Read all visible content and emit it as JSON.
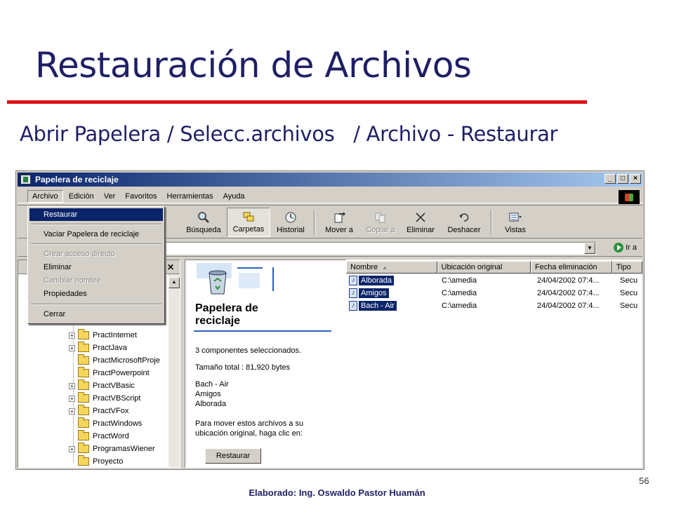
{
  "slide": {
    "title": "Restauración de Archivos",
    "subtitle": "Abrir Papelera / Selecc.archivos   / Archivo - Restaurar",
    "author": "Elaborado: Ing. Oswaldo Pastor Huamán",
    "page_number": "56"
  },
  "window": {
    "title": "Papelera de reciclaje",
    "buttons": {
      "minimize": "_",
      "maximize": "□",
      "close": "×"
    }
  },
  "menubar": [
    "Archivo",
    "Edición",
    "Ver",
    "Favoritos",
    "Herramientas",
    "Ayuda"
  ],
  "file_menu": {
    "items": [
      {
        "label": "Restaurar",
        "state": "highlighted"
      },
      {
        "label": "Vaciar Papelera de reciclaje",
        "state": "normal"
      },
      {
        "label": "Crear acceso directo",
        "state": "disabled"
      },
      {
        "label": "Eliminar",
        "state": "normal"
      },
      {
        "label": "Cambiar nombre",
        "state": "disabled"
      },
      {
        "label": "Propiedades",
        "state": "normal"
      },
      {
        "label": "Cerrar",
        "state": "normal"
      }
    ]
  },
  "toolbar": {
    "buttons": [
      {
        "label": "Búsqueda",
        "icon": "search-icon"
      },
      {
        "label": "Carpetas",
        "icon": "folders-icon"
      },
      {
        "label": "Historial",
        "icon": "history-icon"
      },
      {
        "label": "Mover a",
        "icon": "move-to-icon"
      },
      {
        "label": "Copiar a",
        "icon": "copy-to-icon"
      },
      {
        "label": "Eliminar",
        "icon": "delete-icon"
      },
      {
        "label": "Deshacer",
        "icon": "undo-icon"
      },
      {
        "label": "Vistas",
        "icon": "views-icon"
      }
    ]
  },
  "address": {
    "go_label": "Ir a"
  },
  "tree": {
    "items": [
      {
        "label": "PractInternet",
        "expandable": true
      },
      {
        "label": "PractJava",
        "expandable": true
      },
      {
        "label": "PractMicrosoftProje",
        "expandable": false
      },
      {
        "label": "PractPowerpoint",
        "expandable": false
      },
      {
        "label": "PractVBasic",
        "expandable": true
      },
      {
        "label": "PractVBScript",
        "expandable": true
      },
      {
        "label": "PractVFox",
        "expandable": true
      },
      {
        "label": "PractWindows",
        "expandable": false
      },
      {
        "label": "PractWord",
        "expandable": false
      },
      {
        "label": "ProgramasWiener",
        "expandable": true
      },
      {
        "label": "Proyecto",
        "expandable": false
      }
    ]
  },
  "web_view": {
    "title_line1": "Papelera de",
    "title_line2": "reciclaje",
    "selected_count": "3 componentes seleccionados.",
    "total_size": "Tamaño total : 81,920 bytes",
    "selected_files": [
      "Bach - Air",
      "Amigos",
      "Alborada"
    ],
    "instructions_line1": "Para mover estos archivos a su",
    "instructions_line2": "ubicación original, haga clic en:",
    "restore_button": "Restaurar"
  },
  "file_list": {
    "columns": [
      "Nombre",
      "Ubicación original",
      "Fecha eliminación",
      "Tipo"
    ],
    "rows": [
      {
        "name": "Alborada",
        "location": "C:\\amedia",
        "date": "24/04/2002 07:4...",
        "type": "Secu"
      },
      {
        "name": "Amigos",
        "location": "C:\\amedia",
        "date": "24/04/2002 07:4...",
        "type": "Secu"
      },
      {
        "name": "Bach - Air",
        "location": "C:\\amedia",
        "date": "24/04/2002 07:4...",
        "type": "Secu"
      }
    ]
  },
  "colors": {
    "title_text": "#1f1f66",
    "title_rule": "#e0101a",
    "selection": "#0a246a",
    "window_face": "#d4d0c8"
  }
}
